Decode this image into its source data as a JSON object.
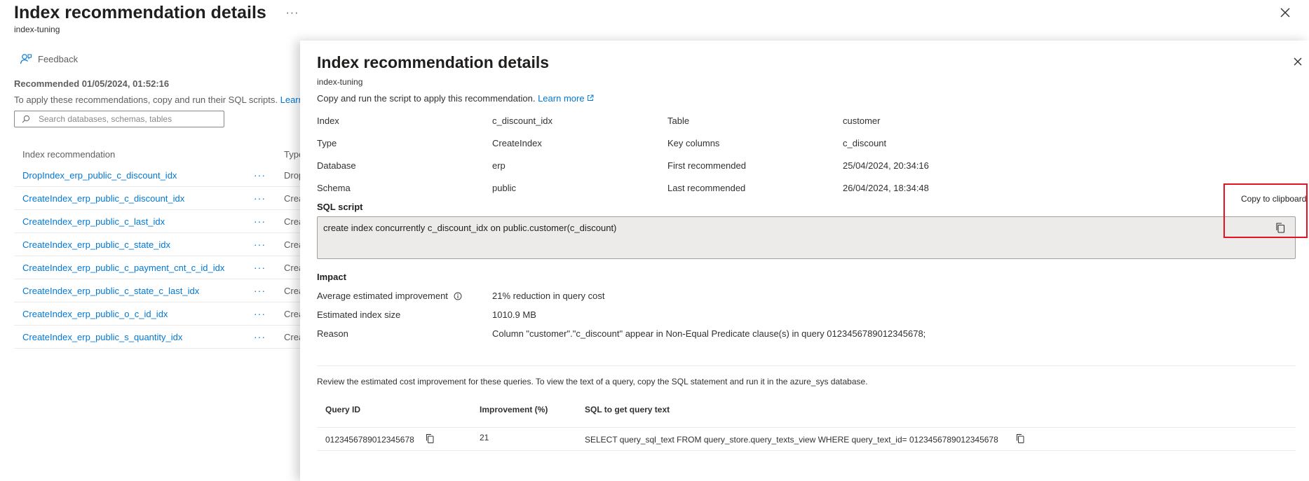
{
  "background": {
    "title": "Index recommendation details",
    "ellipsis": "···",
    "subtitle": "index-tuning",
    "feedback": "Feedback",
    "recommended": "Recommended 01/05/2024, 01:52:16",
    "apply_text": "To apply these recommendations, copy and run their SQL scripts.",
    "apply_link": "Learn",
    "search_placeholder": "Search databases, schemas, tables",
    "columns": [
      "Index recommendation",
      "Type"
    ],
    "rows": [
      {
        "name": "DropIndex_erp_public_c_discount_idx",
        "type": "Drop"
      },
      {
        "name": "CreateIndex_erp_public_c_discount_idx",
        "type": "Crea"
      },
      {
        "name": "CreateIndex_erp_public_c_last_idx",
        "type": "Crea"
      },
      {
        "name": "CreateIndex_erp_public_c_state_idx",
        "type": "Crea"
      },
      {
        "name": "CreateIndex_erp_public_c_payment_cnt_c_id_idx",
        "type": "Crea"
      },
      {
        "name": "CreateIndex_erp_public_c_state_c_last_idx",
        "type": "Crea"
      },
      {
        "name": "CreateIndex_erp_public_o_c_id_idx",
        "type": "Crea"
      },
      {
        "name": "CreateIndex_erp_public_s_quantity_idx",
        "type": "Crea"
      }
    ],
    "row_menu": "···"
  },
  "panel": {
    "title": "Index recommendation details",
    "subtitle": "index-tuning",
    "intro": "Copy and run the script to apply this recommendation.",
    "learn_more": "Learn more",
    "details": {
      "index_label": "Index",
      "index_value": "c_discount_idx",
      "type_label": "Type",
      "type_value": "CreateIndex",
      "database_label": "Database",
      "database_value": "erp",
      "schema_label": "Schema",
      "schema_value": "public",
      "table_label": "Table",
      "table_value": "customer",
      "key_columns_label": "Key columns",
      "key_columns_value": "c_discount",
      "first_rec_label": "First recommended",
      "first_rec_value": "25/04/2024, 20:34:16",
      "last_rec_label": "Last recommended",
      "last_rec_value": "26/04/2024, 18:34:48"
    },
    "sql_heading": "SQL script",
    "sql_script": "create index concurrently c_discount_idx on public.customer(c_discount)",
    "tooltip": "Copy to clipboard",
    "impact_heading": "Impact",
    "impact": {
      "avg_label": "Average estimated improvement",
      "avg_value": "21% reduction in query cost",
      "size_label": "Estimated index size",
      "size_value": "1010.9 MB",
      "reason_label": "Reason",
      "reason_value": "Column \"customer\".\"c_discount\" appear in Non-Equal Predicate clause(s) in query  0123456789012345678;"
    },
    "review_text": "Review the estimated cost improvement for these queries. To view the text of a query, copy the SQL statement and run it in the azure_sys database.",
    "queries": {
      "columns": [
        "Query ID",
        "Improvement (%)",
        "SQL to get query text"
      ],
      "row": {
        "query_id": "0123456789012345678",
        "improvement": "21",
        "sql": "SELECT query_sql_text FROM query_store.query_texts_view WHERE query_text_id= 0123456789012345678"
      }
    }
  },
  "colors": {
    "link": "#0078d4",
    "highlight": "#e81123",
    "code_bg": "#edebe9"
  }
}
